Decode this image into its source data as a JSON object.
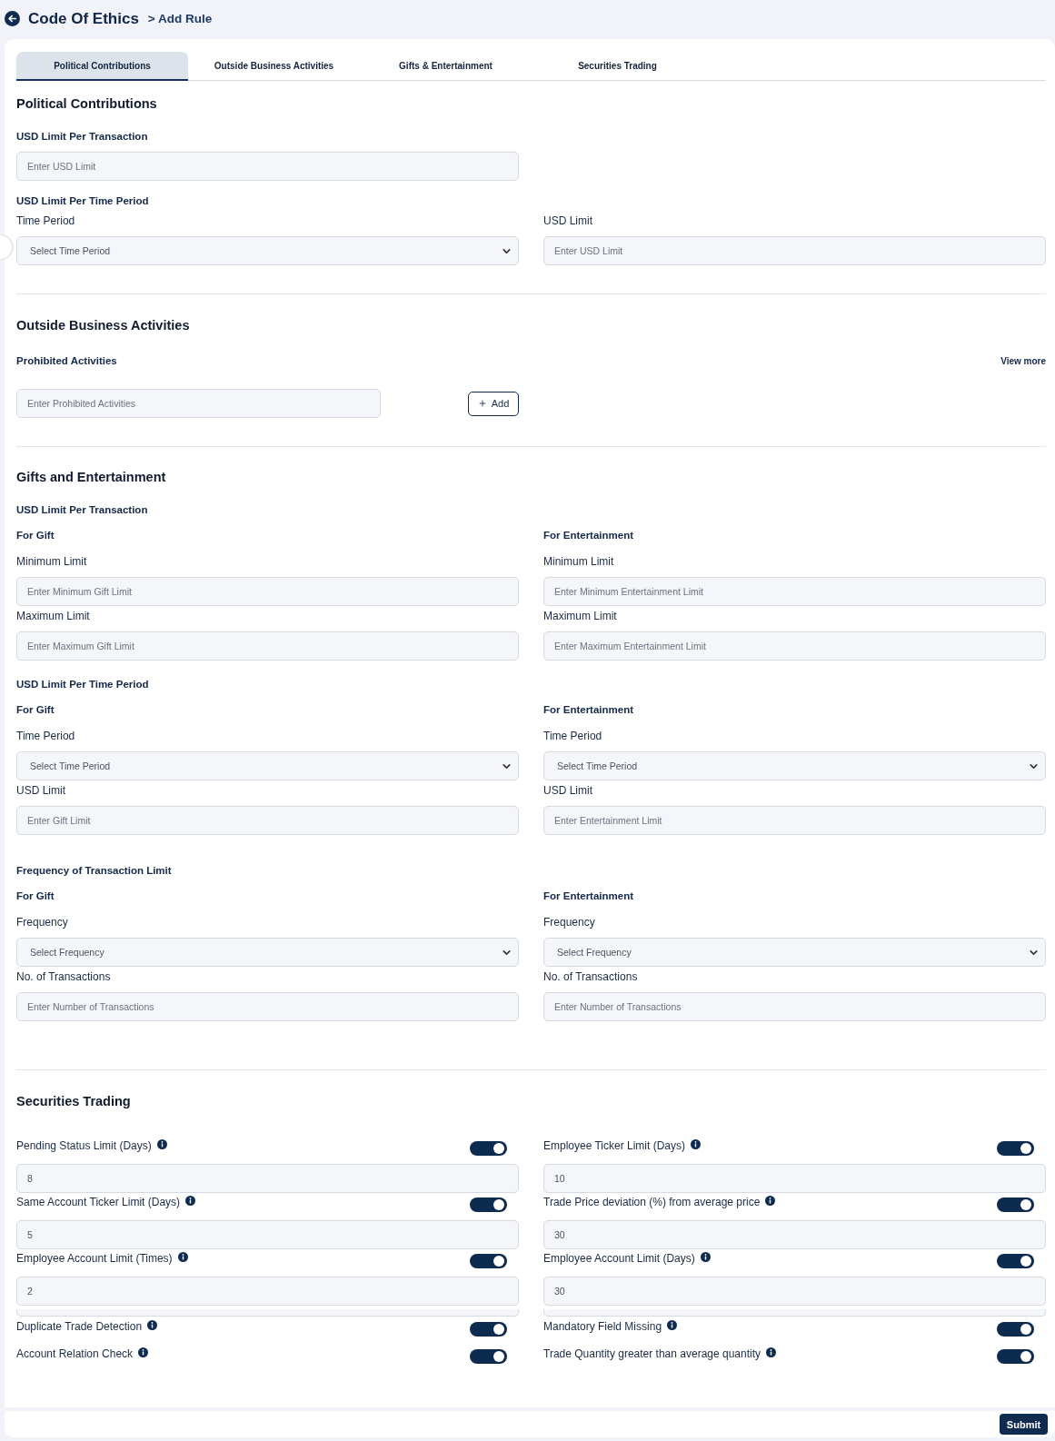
{
  "header": {
    "title": "Code Of Ethics",
    "breadcrumb": "> Add Rule"
  },
  "tabs": [
    {
      "label": "Political Contributions",
      "selected": true
    },
    {
      "label": "Outside Business Activities",
      "selected": false
    },
    {
      "label": "Gifts & Entertainment",
      "selected": false
    },
    {
      "label": "Securities Trading",
      "selected": false
    }
  ],
  "political_contributions": {
    "heading": "Political Contributions",
    "per_transaction": {
      "title": "USD Limit Per Transaction",
      "field": {
        "kind": "input",
        "placeholder": "Enter USD Limit"
      }
    },
    "per_time_period": {
      "title": "USD Limit Per Time Period",
      "fields": [
        {
          "kind": "select",
          "label": "Time Period",
          "placeholder": "Select Time Period"
        },
        {
          "kind": "input",
          "label": "USD Limit",
          "placeholder": "Enter USD Limit"
        }
      ]
    }
  },
  "outside_business_activities": {
    "heading": "Outside Business Activities",
    "title": "Prohibited Activities",
    "view_more": "View more",
    "field": {
      "kind": "input",
      "placeholder": "Enter Prohibited Activities"
    },
    "add_button": "Add"
  },
  "gifts_and_entertainment": {
    "heading": "Gifts and Entertainment",
    "groups": [
      {
        "title": "USD Limit Per Transaction",
        "columns": [
          {
            "title": "For Gift",
            "fields": [
              {
                "kind": "input",
                "label": "Minimum Limit",
                "placeholder": "Enter Minimum Gift Limit"
              },
              {
                "kind": "input",
                "label": "Maximum Limit",
                "placeholder": "Enter Maximum Gift Limit"
              }
            ]
          },
          {
            "title": "For Entertainment",
            "fields": [
              {
                "kind": "input",
                "label": "Minimum Limit",
                "placeholder": "Enter Minimum Entertainment Limit"
              },
              {
                "kind": "input",
                "label": "Maximum Limit",
                "placeholder": "Enter Maximum Entertainment Limit"
              }
            ]
          }
        ]
      },
      {
        "title": "USD Limit Per Time Period",
        "columns": [
          {
            "title": "For Gift",
            "fields": [
              {
                "kind": "select",
                "label": "Time Period",
                "placeholder": "Select Time Period"
              },
              {
                "kind": "input",
                "label": "USD Limit",
                "placeholder": "Enter Gift Limit"
              }
            ]
          },
          {
            "title": "For Entertainment",
            "fields": [
              {
                "kind": "select",
                "label": "Time Period",
                "placeholder": "Select Time Period"
              },
              {
                "kind": "input",
                "label": "USD Limit",
                "placeholder": "Enter Entertainment Limit"
              }
            ]
          }
        ]
      },
      {
        "title": "Frequency of Transaction Limit",
        "columns": [
          {
            "title": "For Gift",
            "fields": [
              {
                "kind": "select",
                "label": "Frequency",
                "placeholder": "Select Frequency"
              },
              {
                "kind": "input",
                "label": "No. of Transactions",
                "placeholder": "Enter Number of Transactions"
              }
            ]
          },
          {
            "title": "For Entertainment",
            "fields": [
              {
                "kind": "select",
                "label": "Frequency",
                "placeholder": "Select Frequency"
              },
              {
                "kind": "input",
                "label": "No. of Transactions",
                "placeholder": "Enter Number of Transactions"
              }
            ]
          }
        ]
      }
    ]
  },
  "securities_trading": {
    "heading": "Securities Trading",
    "columns": [
      {
        "rules": [
          {
            "kind": "limit",
            "label": "Pending Status Limit (Days)",
            "on": true,
            "value": "8"
          },
          {
            "kind": "limit",
            "label": "Same Account Ticker Limit (Days)",
            "on": true,
            "value": "5"
          },
          {
            "kind": "limit",
            "label": "Employee Account Limit (Times)",
            "on": true,
            "value": "2"
          },
          {
            "kind": "clipped_field"
          },
          {
            "kind": "toggle",
            "label": "Duplicate Trade Detection",
            "on": true
          },
          {
            "kind": "toggle",
            "label": "Account Relation Check",
            "on": true
          }
        ]
      },
      {
        "rules": [
          {
            "kind": "limit",
            "label": "Employee Ticker Limit (Days)",
            "on": true,
            "value": "10"
          },
          {
            "kind": "limit",
            "label": "Trade Price deviation (%) from average price",
            "on": true,
            "value": "30"
          },
          {
            "kind": "limit",
            "label": "Employee Account Limit (Days)",
            "on": true,
            "value": "30"
          },
          {
            "kind": "clipped_field"
          },
          {
            "kind": "toggle",
            "label": "Mandatory Field Missing",
            "on": true
          },
          {
            "kind": "toggle",
            "label": "Trade Quantity greater than average quantity",
            "on": true
          }
        ]
      }
    ]
  },
  "footer": {
    "submit": "Submit"
  }
}
